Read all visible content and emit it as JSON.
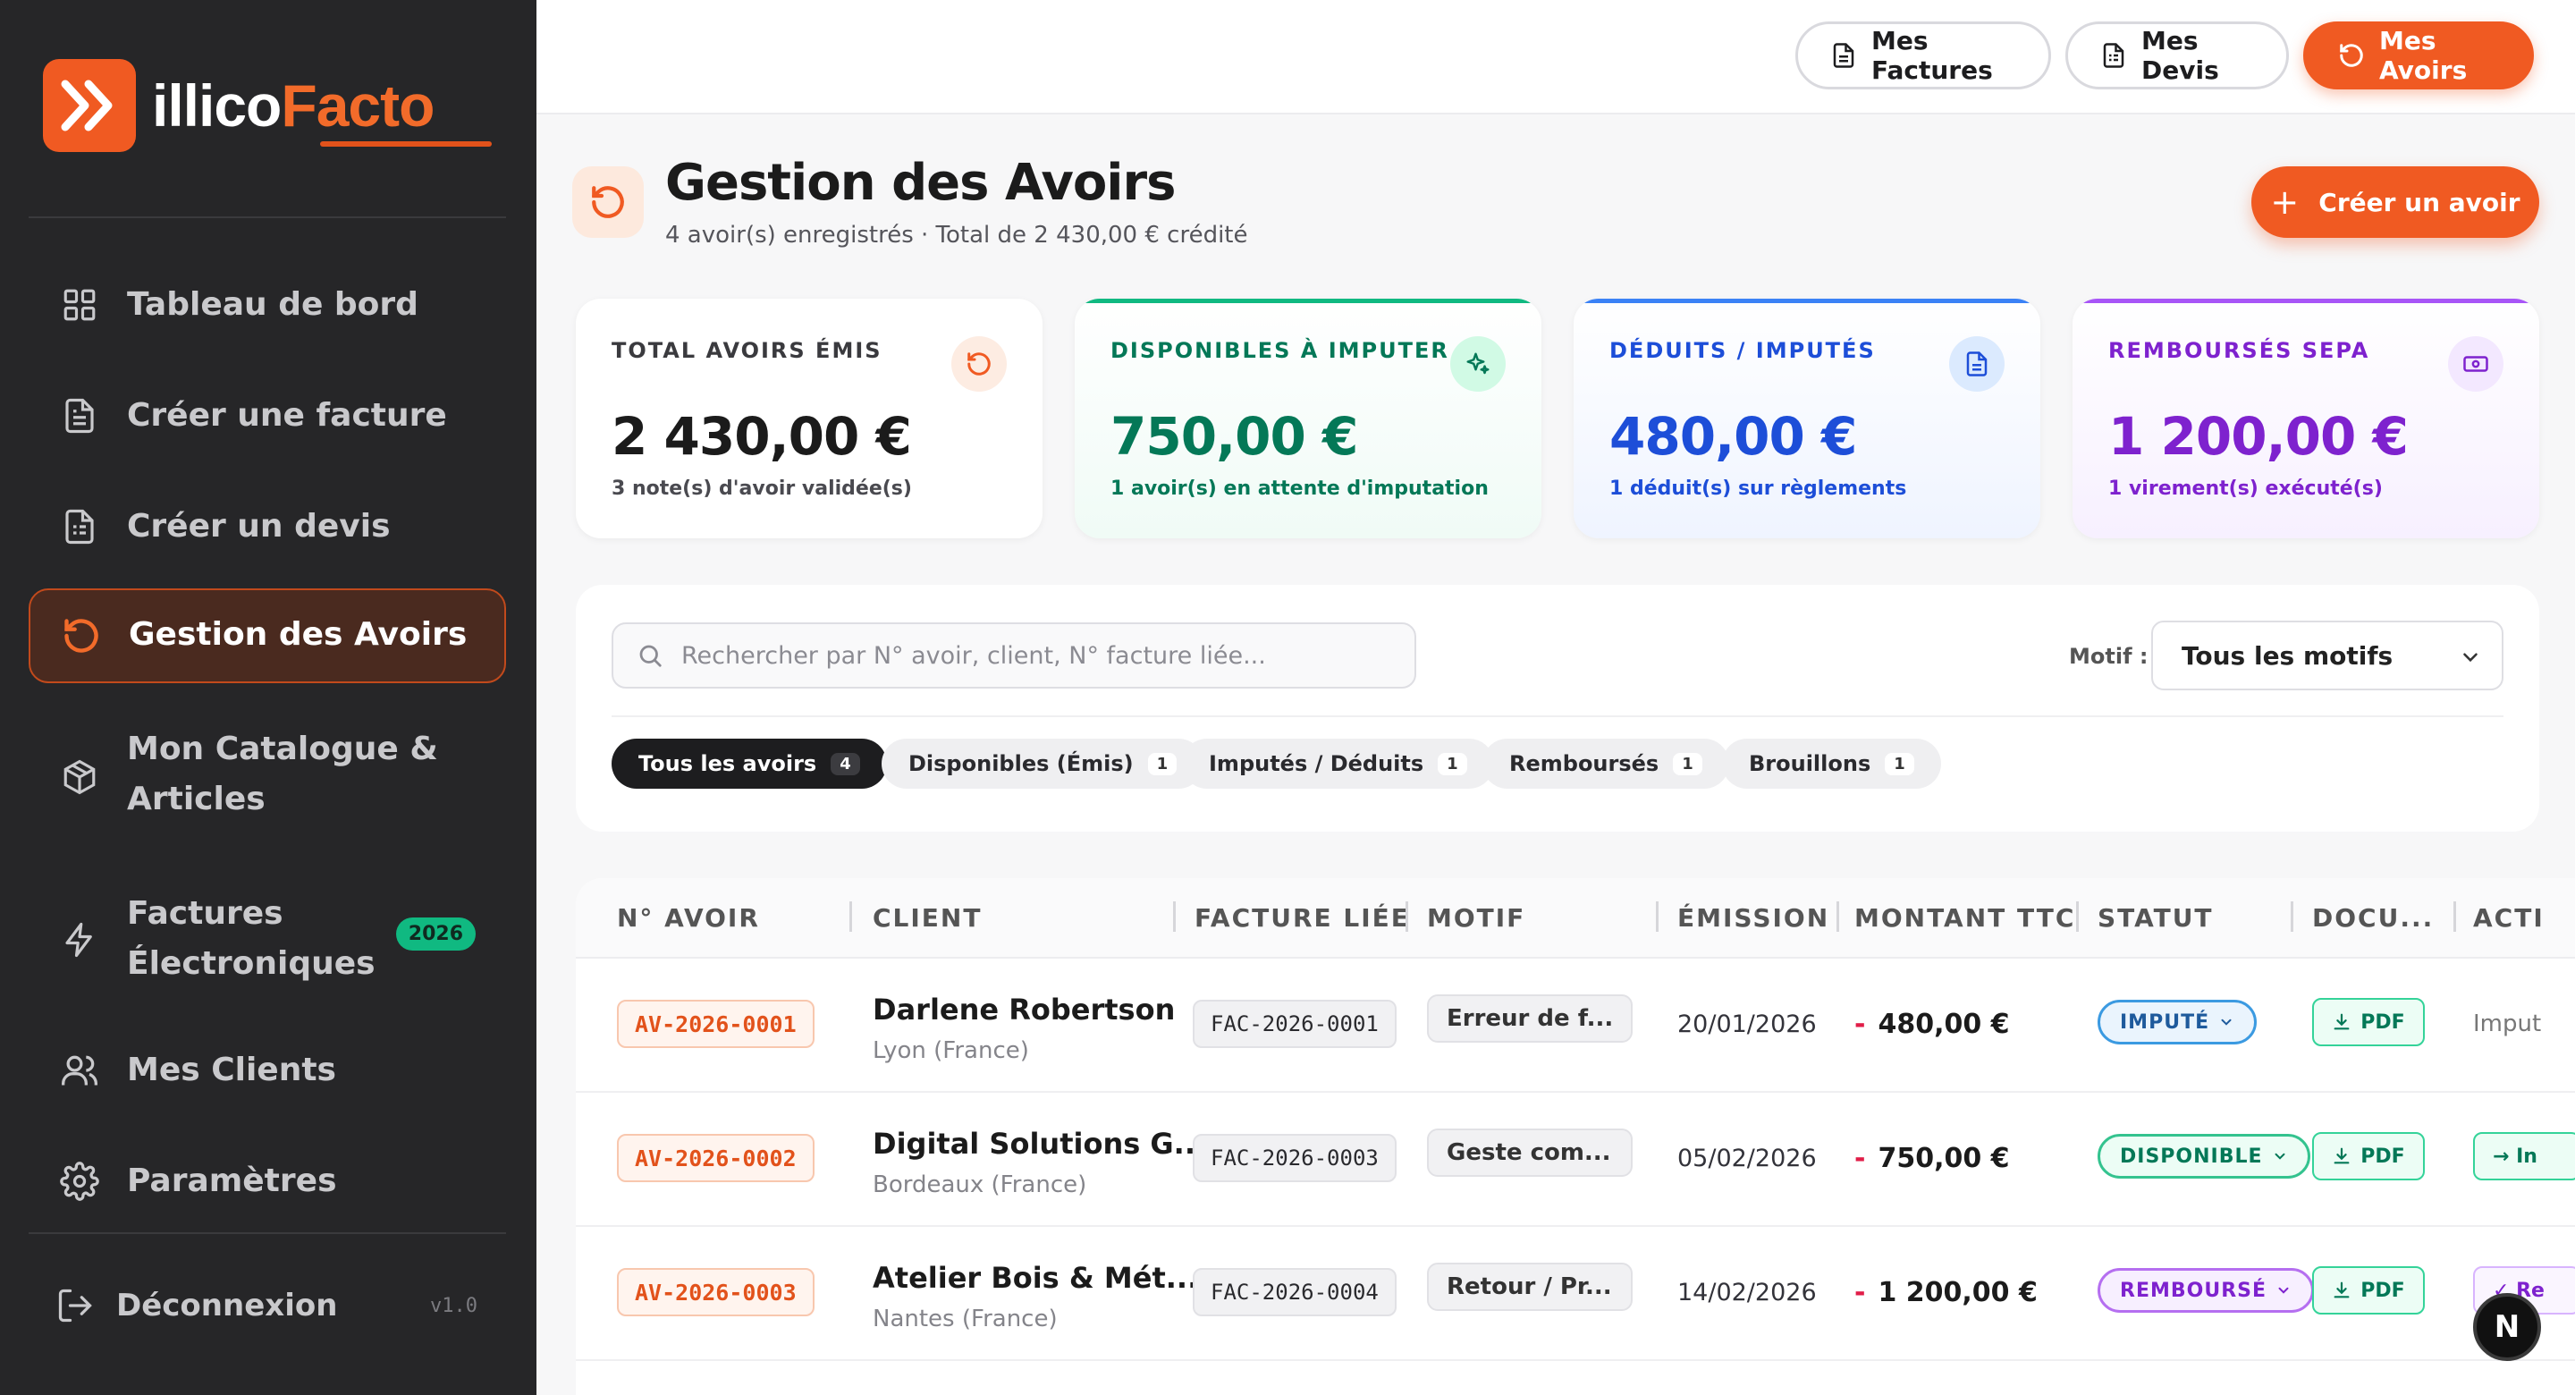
{
  "brand": {
    "name_a": "illico",
    "name_b": "Facto",
    "accent": "#f05a22"
  },
  "sidebar": {
    "items": [
      {
        "label": "Tableau de bord",
        "icon": "grid-icon"
      },
      {
        "label": "Créer une facture",
        "icon": "file-text-icon"
      },
      {
        "label": "Créer un devis",
        "icon": "file-list-icon"
      },
      {
        "label": "Gestion des Avoirs",
        "icon": "rotate-ccw-icon",
        "active": true
      },
      {
        "label_line1": "Mon Catalogue &",
        "label_line2": "Articles",
        "icon": "package-icon"
      },
      {
        "label_line1": "Factures",
        "label_line2": "Électroniques",
        "icon": "bolt-icon",
        "badge": "2026"
      },
      {
        "label": "Mes Clients",
        "icon": "users-icon"
      },
      {
        "label": "Paramètres",
        "icon": "gear-icon"
      }
    ],
    "logout": {
      "label": "Déconnexion",
      "version": "v1.0"
    }
  },
  "topbar": {
    "factures": "Mes Factures",
    "devis": "Mes Devis",
    "avoirs": "Mes Avoirs"
  },
  "header": {
    "title": "Gestion des Avoirs",
    "subtitle": "4 avoir(s) enregistrés · Total de 2 430,00 € crédité",
    "create_label": "Créer un avoir"
  },
  "kpis": [
    {
      "caption": "TOTAL AVOIRS ÉMIS",
      "value": "2 430,00 €",
      "note": "3 note(s) d'avoir validée(s)",
      "color": "#1b1b1b",
      "icon": "rotate-ccw-icon"
    },
    {
      "caption": "DISPONIBLES À IMPUTER",
      "value": "750,00 €",
      "note": "1 avoir(s) en attente d'imputation",
      "color": "#047857",
      "icon": "sparkles-icon"
    },
    {
      "caption": "DÉDUITS / IMPUTÉS",
      "value": "480,00 €",
      "note": "1 déduit(s) sur règlements",
      "color": "#1d4ed8",
      "icon": "file-text-icon"
    },
    {
      "caption": "REMBOURSÉS SEPA",
      "value": "1 200,00 €",
      "note": "1 virement(s) exécuté(s)",
      "color": "#7e22ce",
      "icon": "banknote-icon"
    }
  ],
  "filters": {
    "search_placeholder": "Rechercher par N° avoir, client, N° facture liée...",
    "motif_label": "Motif :",
    "motif_value": "Tous les motifs",
    "chips": [
      {
        "label": "Tous les avoirs",
        "count": "4",
        "active": true
      },
      {
        "label": "Disponibles (Émis)",
        "count": "1"
      },
      {
        "label": "Imputés / Déduits",
        "count": "1"
      },
      {
        "label": "Remboursés",
        "count": "1"
      },
      {
        "label": "Brouillons",
        "count": "1"
      }
    ]
  },
  "table": {
    "headers": [
      "N° AVOIR",
      "CLIENT",
      "FACTURE LIÉE",
      "MOTIF",
      "ÉMISSION",
      "MONTANT TTC",
      "STATUT",
      "DOCU...",
      "ACTI"
    ],
    "rows": [
      {
        "num": "AV-2026-0001",
        "client": "Darlene Robertson",
        "location": "Lyon (France)",
        "facture": "FAC-2026-0001",
        "motif": "Erreur de f...",
        "date": "20/01/2026",
        "sign": "-",
        "amount": "480,00 €",
        "status": "IMPUTÉ",
        "doc": "PDF",
        "action": "Imput"
      },
      {
        "num": "AV-2026-0002",
        "client": "Digital Solutions G...",
        "location": "Bordeaux (France)",
        "facture": "FAC-2026-0003",
        "motif": "Geste com...",
        "date": "05/02/2026",
        "sign": "-",
        "amount": "750,00 €",
        "status": "DISPONIBLE",
        "doc": "PDF",
        "action": "→ In"
      },
      {
        "num": "AV-2026-0003",
        "client": "Atelier Bois & Mét...",
        "location": "Nantes (France)",
        "facture": "FAC-2026-0004",
        "motif": "Retour / Pr...",
        "date": "14/02/2026",
        "sign": "-",
        "amount": "1 200,00 €",
        "status": "REMBOURSÉ",
        "doc": "PDF",
        "action": "✓ Re"
      }
    ]
  },
  "fab": {
    "label": "N"
  }
}
